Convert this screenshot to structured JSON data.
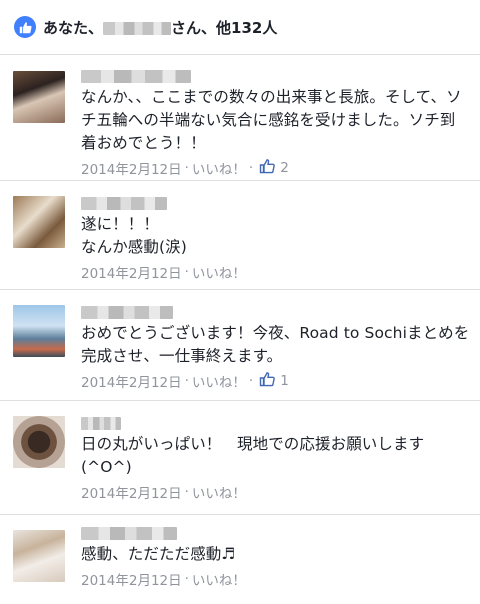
{
  "likes_bar": {
    "text": "あなた、　　　　さん、他132人"
  },
  "likes_prefix": "あなた、",
  "likes_suffix": "さん、他132人",
  "comments": [
    {
      "text": "なんか、、ここまでの数々の出来事と長旅。そして、ソチ五輪への半端ない気合に感銘を受けました。ソチ到着おめでとう！！",
      "date": "2014年2月12日",
      "like_label": "いいね！",
      "likes": "2"
    },
    {
      "text": "遂に！！！\nなんか感動(涙)",
      "date": "2014年2月12日",
      "like_label": "いいね！",
      "likes": ""
    },
    {
      "text": "おめでとうございます！今夜、Road to Sochiまとめを完成させ、一仕事終えます。",
      "date": "2014年2月12日",
      "like_label": "いいね！",
      "likes": "1"
    },
    {
      "text": "日の丸がいっぱい！　現地での応援お願いします(^O^)",
      "date": "2014年2月12日",
      "like_label": "いいね！",
      "likes": ""
    },
    {
      "text": "感動、ただただ感動♬",
      "date": "2014年2月12日",
      "like_label": "いいね！",
      "likes": ""
    }
  ],
  "colors": {
    "like_blue": "#4080ff",
    "meta_gray": "#90949c",
    "divider": "#dddfe2"
  },
  "icons": {
    "like_badge": "thumbs-up-icon",
    "like_count": "thumbs-up-outline-icon"
  }
}
